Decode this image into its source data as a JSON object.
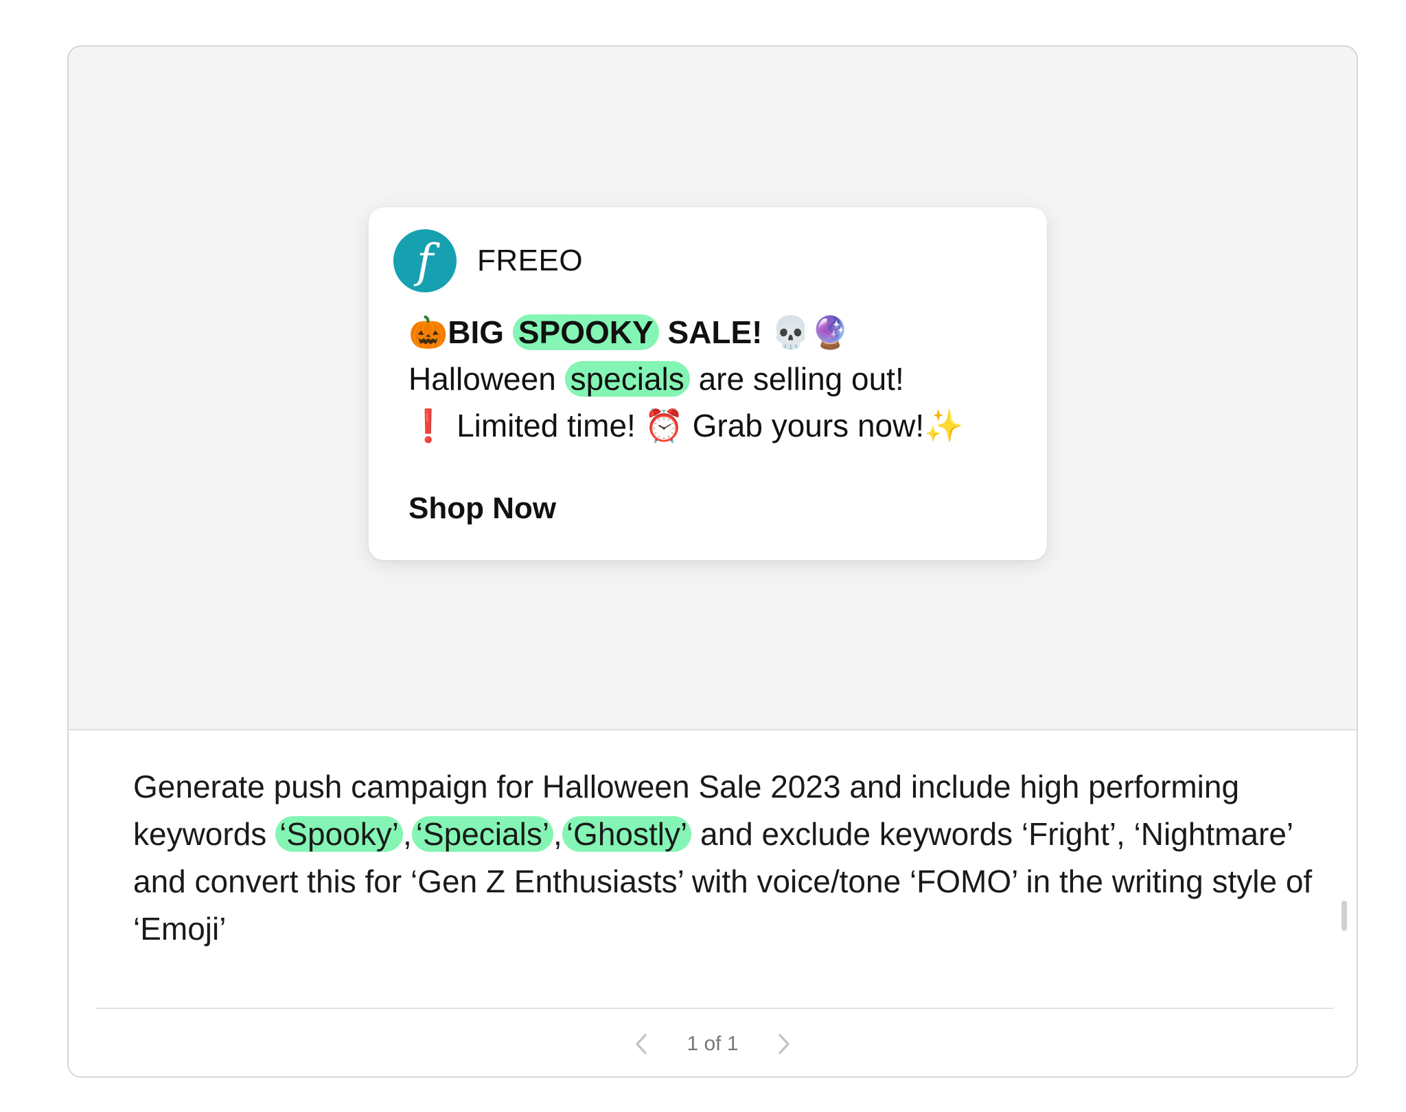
{
  "notification": {
    "app_logo_letter": "f",
    "app_name": "FREEO",
    "title": {
      "emoji_lead": "🎃",
      "before": "BIG",
      "keyword": "SPOOKY",
      "after": "SALE!",
      "emoji_trail": "💀🔮"
    },
    "line2": {
      "before": "Halloween",
      "keyword": "specials",
      "after": "are selling out!"
    },
    "line3": {
      "emoji_lead": "❗",
      "text1": "Limited time!",
      "emoji_mid": "⏰",
      "text2": "Grab yours now!",
      "emoji_trail": "✨"
    },
    "cta_label": "Shop Now"
  },
  "prompt": {
    "part1": "Generate push campaign for Halloween Sale 2023 and include high performing keywords",
    "keyword1": "‘Spooky’",
    "sep1": ",",
    "keyword2": "‘Specials’",
    "sep2": ",",
    "keyword3": "‘Ghostly’",
    "part2": "and exclude keywords ‘Fright’, ‘Nightmare’ and convert this for ‘Gen Z Enthusiasts’ with voice/tone ‘FOMO’ in the writing style of ‘Emoji’"
  },
  "pager": {
    "text": "1 of 1",
    "prev_icon": "chevron-left-icon",
    "next_icon": "chevron-right-icon"
  },
  "colors": {
    "highlight": "#84f5b4",
    "logo": "#16a0b0",
    "preview_bg": "#f4f4f4"
  }
}
